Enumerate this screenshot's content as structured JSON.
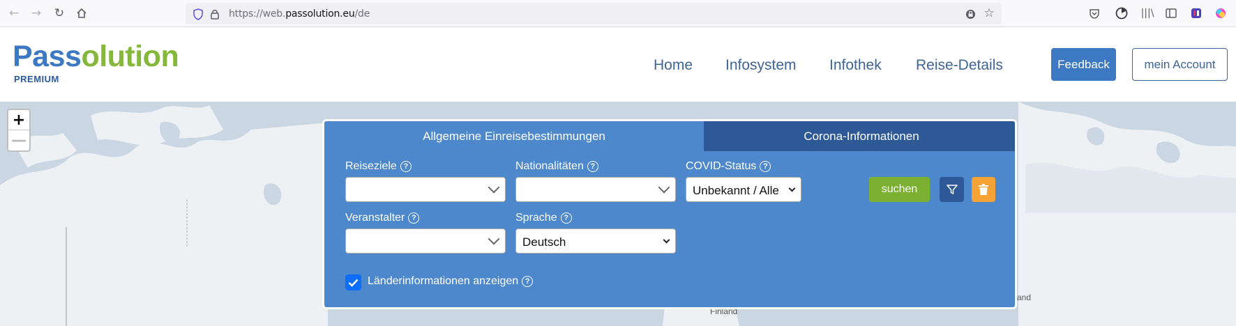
{
  "browser": {
    "url_prefix": "https://web.",
    "url_host": "passolution.eu",
    "url_path": "/de"
  },
  "header": {
    "logo_part1": "Pass",
    "logo_part2": "olution",
    "logo_sub": "PREMIUM",
    "nav": [
      "Home",
      "Infosystem",
      "Infothek",
      "Reise-Details"
    ],
    "feedback_label": "Feedback",
    "account_label": "mein Account"
  },
  "map": {
    "zoom_in": "+",
    "zoom_out": "—",
    "label_finland": "Finland",
    "label_land": "and"
  },
  "panel": {
    "tabs": [
      "Allgemeine Einreisebestimmungen",
      "Corona-Informationen"
    ],
    "reiseziele_label": "Reiseziele",
    "nationalitaeten_label": "Nationalitäten",
    "covid_label": "COVID-Status",
    "covid_value": "Unbekannt / Alle",
    "suchen_label": "suchen",
    "veranstalter_label": "Veranstalter",
    "sprache_label": "Sprache",
    "sprache_value": "Deutsch",
    "laender_label": "Länderinformationen anzeigen",
    "help_glyph": "?"
  },
  "colors": {
    "brand_blue": "#3d79c2",
    "brand_green": "#85b83a",
    "panel_bg": "#4d88cc",
    "tab_dark": "#2d5a97",
    "suchen_green": "#7cb030",
    "trash_orange": "#f7a234"
  }
}
